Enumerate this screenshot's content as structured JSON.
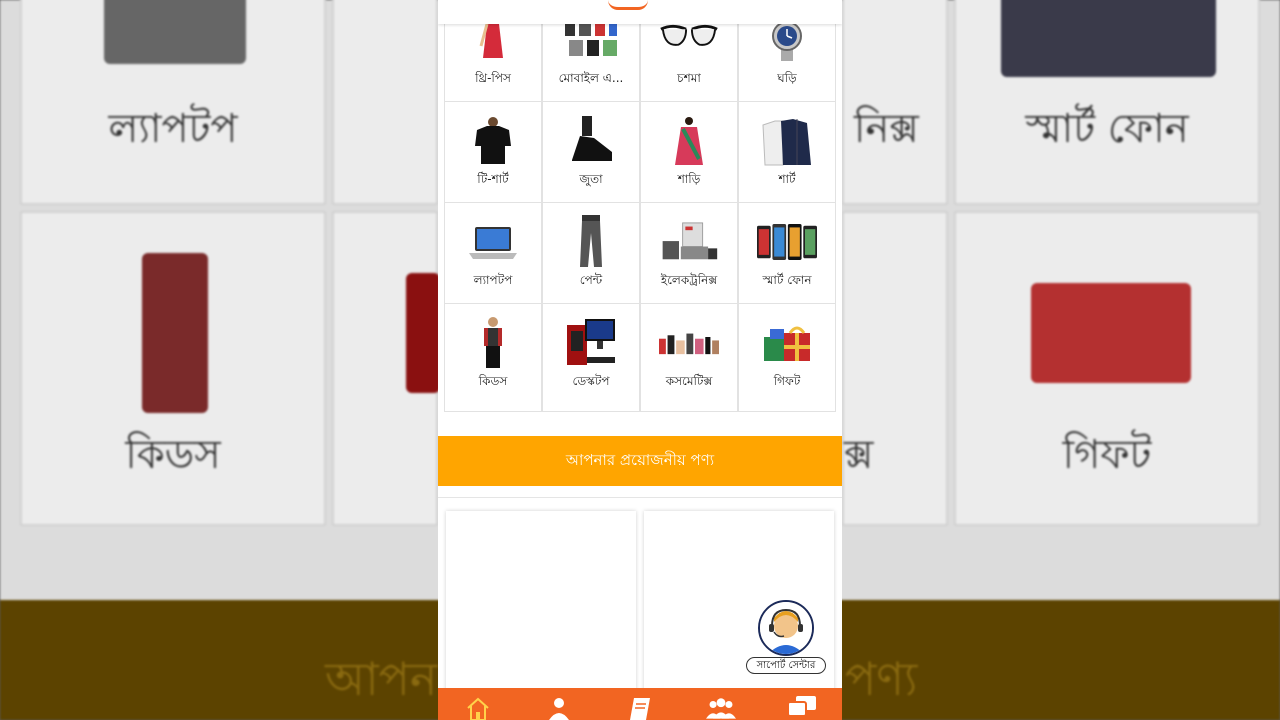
{
  "background": {
    "labels": [
      "ল্যাপটপ",
      "নিক্স",
      "স্মার্ট ফোন",
      "কিডস",
      "ক্স",
      "গিফট"
    ],
    "band_text_left": "আপন",
    "band_text_right": "পণ্য"
  },
  "categories": [
    {
      "label": "থ্রি-পিস",
      "icon": "three-piece-dress-icon"
    },
    {
      "label": "মোবাইল এ...",
      "icon": "mobile-accessories-icon"
    },
    {
      "label": "চশমা",
      "icon": "glasses-icon"
    },
    {
      "label": "ঘড়ি",
      "icon": "watch-icon"
    },
    {
      "label": "টি-শার্ট",
      "icon": "tshirt-icon"
    },
    {
      "label": "জুতা",
      "icon": "shoes-icon"
    },
    {
      "label": "শাড়ি",
      "icon": "saree-icon"
    },
    {
      "label": "শার্ট",
      "icon": "shirt-icon"
    },
    {
      "label": "ল্যাপটপ",
      "icon": "laptop-icon"
    },
    {
      "label": "পেন্ট",
      "icon": "pants-icon"
    },
    {
      "label": "ইলেকট্রনিক্স",
      "icon": "electronics-icon"
    },
    {
      "label": "স্মার্ট ফোন",
      "icon": "smartphone-icon"
    },
    {
      "label": "কিডস",
      "icon": "kids-icon"
    },
    {
      "label": "ডেস্কটপ",
      "icon": "desktop-icon"
    },
    {
      "label": "কসমেটিক্স",
      "icon": "cosmetics-icon"
    },
    {
      "label": "গিফট",
      "icon": "gift-icon"
    }
  ],
  "section": {
    "title": "আপনার প্রয়োজনীয় পণ্য"
  },
  "support": {
    "label": "সাপোর্ট সেন্টার"
  },
  "bottom_nav": [
    "home-icon",
    "user-icon",
    "book-icon",
    "group-icon",
    "chat-icon"
  ],
  "colors": {
    "accent": "#f26522",
    "section_bar": "#ffa500"
  }
}
